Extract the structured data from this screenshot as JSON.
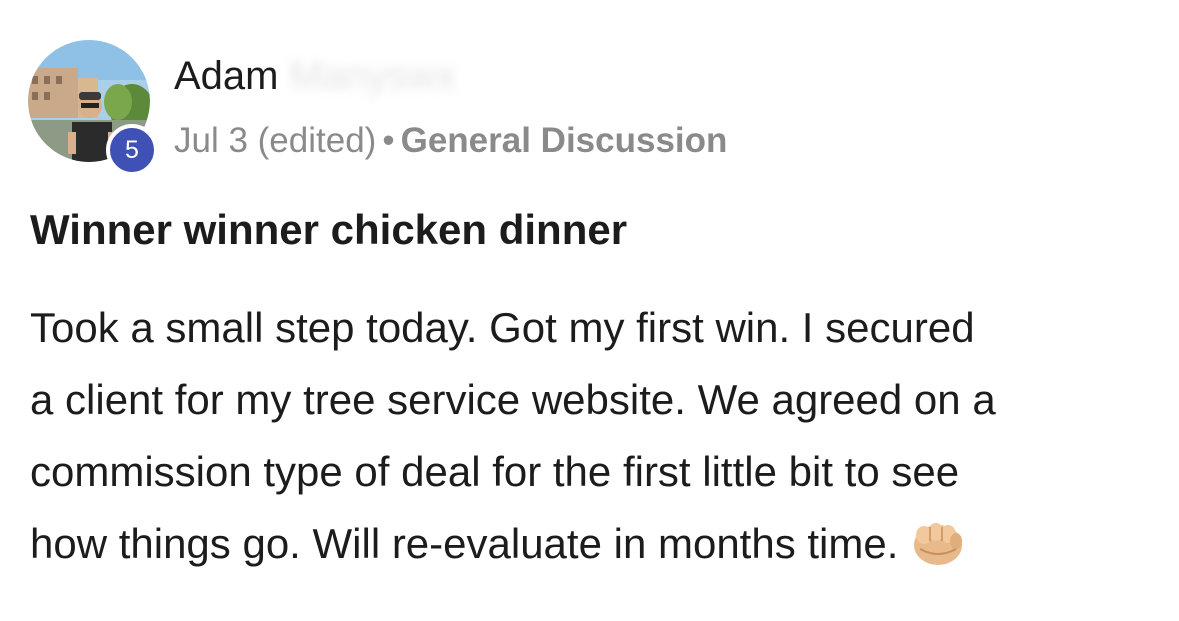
{
  "post": {
    "author": {
      "first_name": "Adam",
      "last_name_obscured": "Manyswx",
      "level": "5"
    },
    "date": "Jul 3 (edited)",
    "separator": "•",
    "category": "General Discussion",
    "title": "Winner winner chicken dinner",
    "body_lines": [
      "Took a small step today. Got my first win. I secured",
      "a client for my tree service website. We agreed on a",
      "commission type of deal for the first little bit to see",
      "how things go. Will re-evaluate in months time."
    ],
    "emoji": "fist-bump-icon"
  },
  "colors": {
    "level_badge": "#3f51b5",
    "meta_text": "#8a8a8a",
    "text": "#1c1c1c"
  }
}
